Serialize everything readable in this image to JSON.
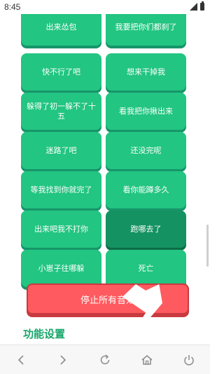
{
  "status": {
    "time": "8:45"
  },
  "sounds": [
    {
      "label": "出来怂包"
    },
    {
      "label": "我要把你们都刹了"
    },
    {
      "label": "快不行了吧"
    },
    {
      "label": "想来干掉我"
    },
    {
      "label": "躲得了初一躲不了十五"
    },
    {
      "label": "看我把你揪出来"
    },
    {
      "label": "迷路了吧"
    },
    {
      "label": "还没完呢"
    },
    {
      "label": "等我找到你就完了"
    },
    {
      "label": "看你能蹲多久"
    },
    {
      "label": "出来吧我不打你"
    },
    {
      "label": "跑哪去了",
      "active": true
    },
    {
      "label": "小崽子往哪躲"
    },
    {
      "label": "死亡"
    }
  ],
  "stop_all": {
    "label": "停止所有音效"
  },
  "settings": {
    "title": "功能设置"
  },
  "colors": {
    "primary": "#22c581",
    "primary_dark": "#149262",
    "danger": "#ff5a5f",
    "title_green": "#16a66a"
  },
  "nav": [
    "back-icon",
    "forward-icon",
    "refresh-icon",
    "home-icon",
    "power-icon"
  ]
}
